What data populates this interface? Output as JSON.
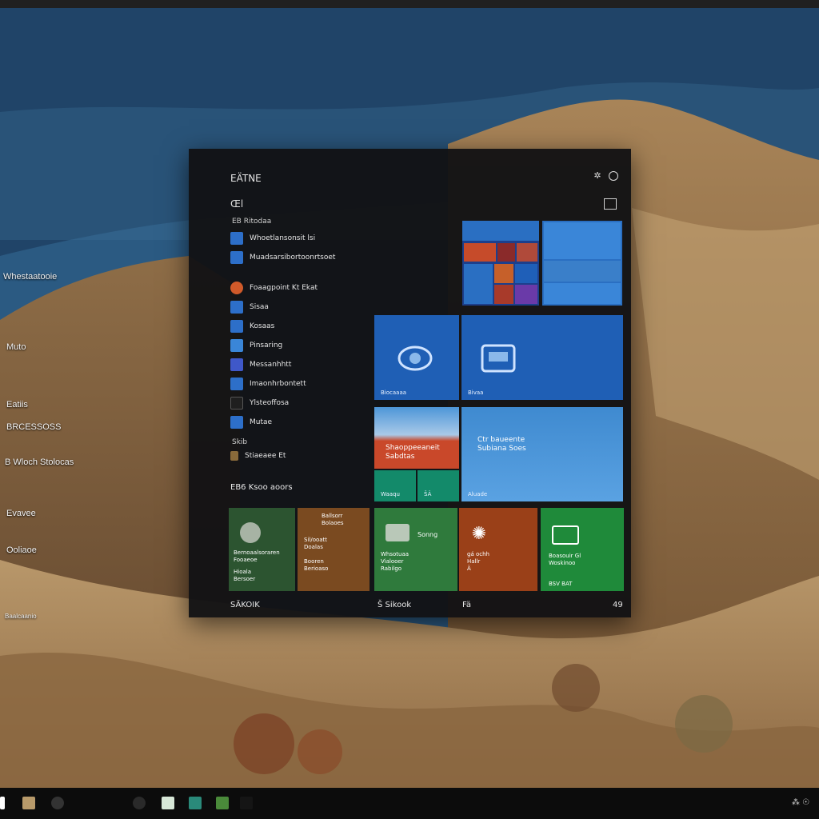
{
  "start_menu": {
    "title": "EÄTNE",
    "left_header": "Œl",
    "section_a": "EB Ritodaa",
    "apps": [
      {
        "label": "Whoetlansonsit lsi",
        "color": "#2d6fc9"
      },
      {
        "label": "Muadsarsibortoonrtsoet",
        "color": "#2d6fc9"
      }
    ],
    "apps_b": [
      {
        "label": "Foaagpoint Kt Ekat",
        "color": "#d05a2a"
      },
      {
        "label": "Sisaa",
        "color": "#2d6fc9"
      },
      {
        "label": "Kosaas",
        "color": "#2d6fc9"
      },
      {
        "label": "Pinsaring",
        "color": "#3a86d8"
      },
      {
        "label": "Messanhhtt",
        "color": "#3f58c9"
      },
      {
        "label": "Imaonhrbontett",
        "color": "#2d6fc9"
      },
      {
        "label": "Ylsteoffosa",
        "color": "#1f1f1f"
      },
      {
        "label": "Mutae",
        "color": "#2d6fc9"
      }
    ],
    "section_c": "Skib",
    "last_app": {
      "label": "Stiaeaee Et",
      "color": "#8a6a3a"
    },
    "footer_left": "EB6 Ksoo aoors",
    "bottom_labels": [
      "SÄKOIK",
      "Š Sikook",
      "Fä"
    ],
    "bottom_right": "49"
  },
  "tiles": {
    "t1_caption": "Biocaaaa",
    "t2_caption": "Bivaa",
    "t3_text": "Shaoppeeaneit\nSabdtas",
    "t4_text": "Ctr baueente\nSubiana Soes",
    "t4_caption": "Aluade",
    "t5_caption": "Waaqu",
    "t6_caption": "ŠÄ",
    "g1_title": "Bernoaalsoraren\nFooaeoe",
    "g1_sub": "Hioala\nBersoer",
    "g2_title": "Ballsorr\nBolaoes",
    "g2_sub": "Sil/ooatt\nDoalas\n\nBooren\nBerioaso",
    "g3_title": "Sonng",
    "g3_sub": "Whsotuaa\nVialooer\nRabilgo",
    "g4_title": "gá ochh\nHallr\nÄ",
    "g5_title": "Boasouir Gl\nWoskinoo",
    "g5_sub": "BSV BAT"
  },
  "desktop": [
    "Whestaatooie",
    "Muto",
    "Eatiis",
    "BRCESSOSS",
    "B Wloch Stolocas",
    "Evavee",
    "Ooliaoe",
    "Baalcaanio"
  ],
  "taskbar": {
    "icons": [
      "windows-icon",
      "explorer-icon",
      "chat-icon",
      "settings-icon",
      "store-icon",
      "photos-icon",
      "media-icon",
      "network-icon"
    ],
    "tray": "⁂  ☉"
  },
  "colors": {
    "tile_blue": "#2a6fc2",
    "tile_light": "#4a8fd8",
    "tile_green": "#2f7a3c",
    "tile_orange": "#a84a1e",
    "tile_teal": "#138a6a"
  }
}
